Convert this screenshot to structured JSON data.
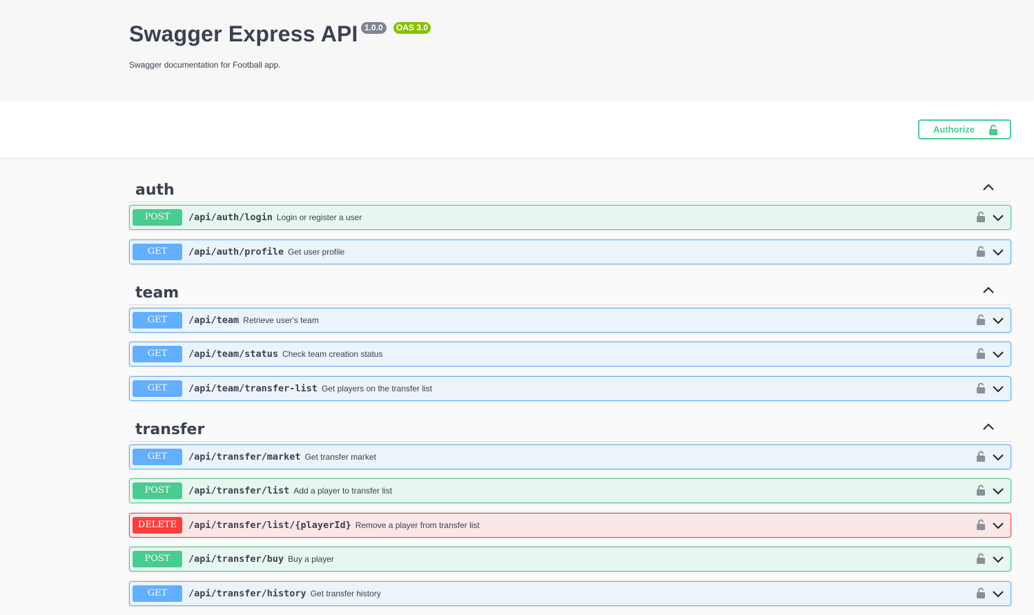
{
  "info": {
    "title": "Swagger Express API",
    "version": "1.0.0",
    "oas": "OAS 3.0",
    "description": "Swagger documentation for Football app."
  },
  "authorize": {
    "label": "Authorize",
    "icon": "unlocked-lock-icon",
    "color": "#49cc90"
  },
  "colors": {
    "post": "#49cc90",
    "get": "#61affe",
    "delete": "#f93e3e"
  },
  "tags": [
    {
      "name": "auth",
      "operations": [
        {
          "method": "POST",
          "path": "/api/auth/login",
          "summary": "Login or register a user"
        },
        {
          "method": "GET",
          "path": "/api/auth/profile",
          "summary": "Get user profile"
        }
      ]
    },
    {
      "name": "team",
      "operations": [
        {
          "method": "GET",
          "path": "/api/team",
          "summary": "Retrieve user's team"
        },
        {
          "method": "GET",
          "path": "/api/team/status",
          "summary": "Check team creation status"
        },
        {
          "method": "GET",
          "path": "/api/team/transfer-list",
          "summary": "Get players on the transfer list"
        }
      ]
    },
    {
      "name": "transfer",
      "operations": [
        {
          "method": "GET",
          "path": "/api/transfer/market",
          "summary": "Get transfer market"
        },
        {
          "method": "POST",
          "path": "/api/transfer/list",
          "summary": "Add a player to transfer list"
        },
        {
          "method": "DELETE",
          "path": "/api/transfer/list/{playerId}",
          "summary": "Remove a player from transfer list"
        },
        {
          "method": "POST",
          "path": "/api/transfer/buy",
          "summary": "Buy a player"
        },
        {
          "method": "GET",
          "path": "/api/transfer/history",
          "summary": "Get transfer history"
        }
      ]
    }
  ]
}
